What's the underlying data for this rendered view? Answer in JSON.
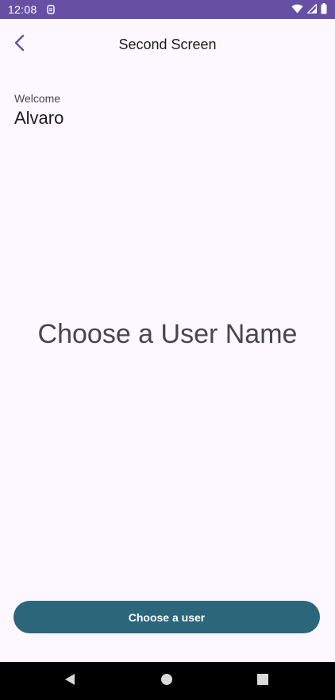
{
  "status_bar": {
    "time": "12:08",
    "icons": [
      "sim-card-icon",
      "wifi-icon",
      "signal-icon",
      "battery-icon"
    ],
    "background": "#6750a4"
  },
  "app_bar": {
    "title": "Second Screen",
    "back_icon": "chevron-left-icon",
    "accent": "#6750a4"
  },
  "welcome": {
    "label": "Welcome",
    "name": "Alvaro"
  },
  "main": {
    "heading": "Choose a User Name"
  },
  "actions": {
    "choose_user_label": "Choose a user",
    "button_color": "#2b667b"
  },
  "nav_bar": {
    "icons": [
      "back-triangle-icon",
      "home-circle-icon",
      "recents-square-icon"
    ]
  }
}
